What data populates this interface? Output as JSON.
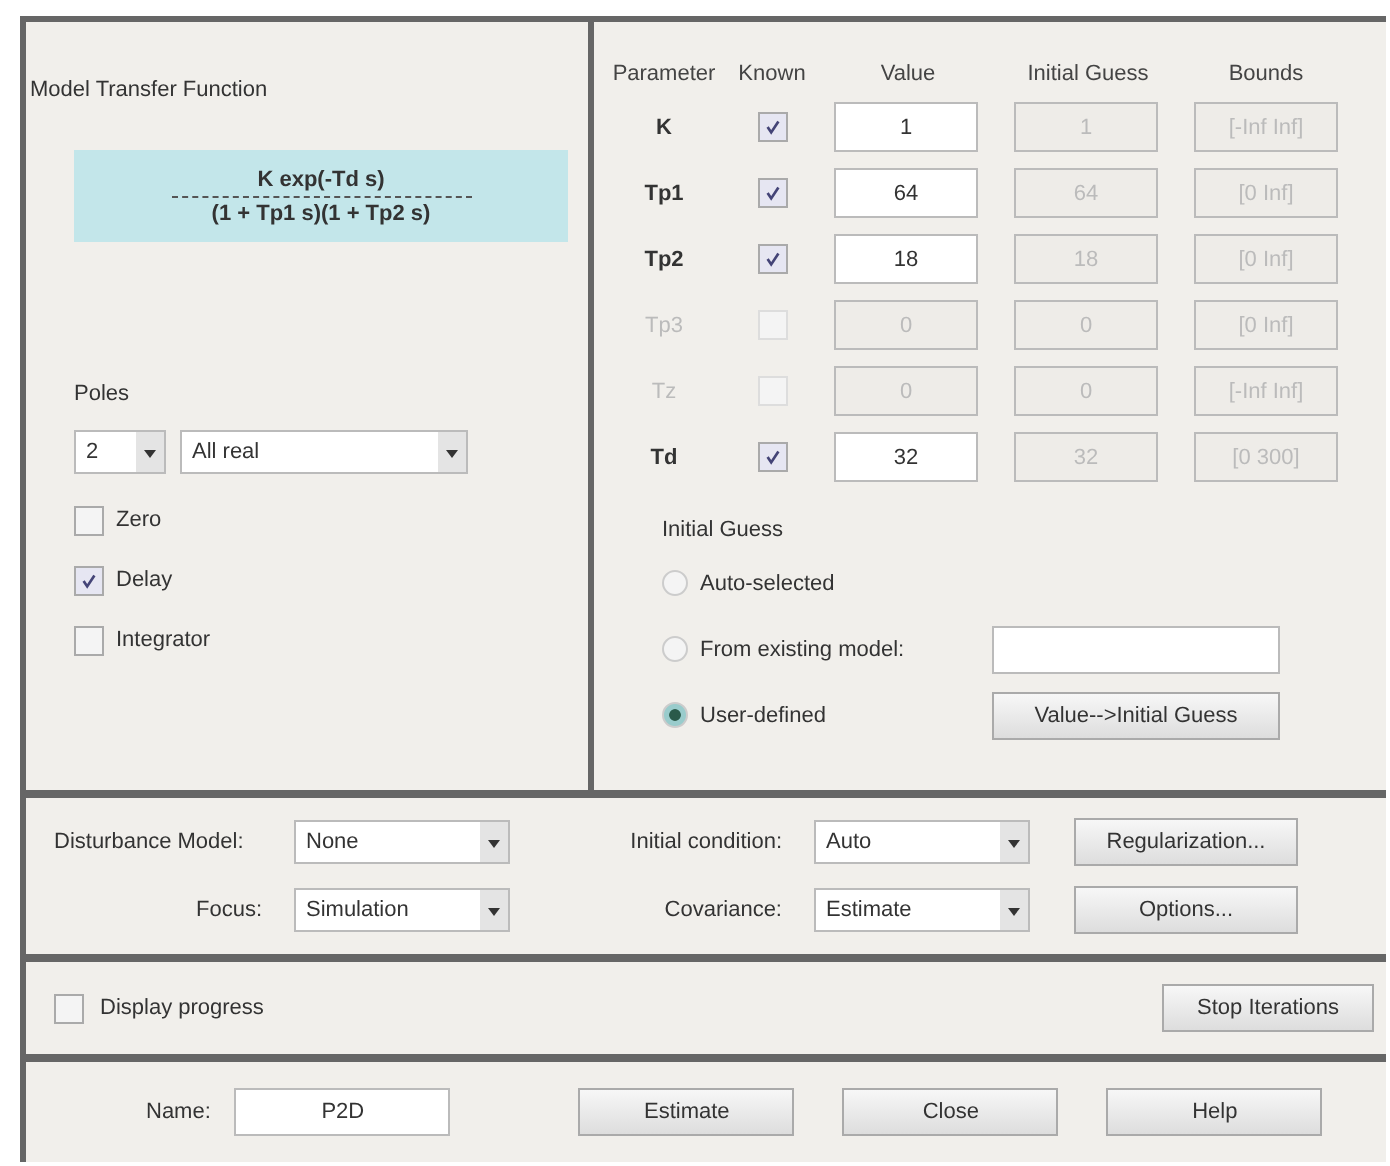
{
  "model_panel": {
    "title": "Model Transfer Function",
    "numerator": "K exp(-Td s)",
    "denominator": "(1 + Tp1 s)(1 + Tp2 s)",
    "poles_label": "Poles",
    "poles_count": "2",
    "poles_type": "All real",
    "options": [
      {
        "label": "Zero",
        "checked": false
      },
      {
        "label": "Delay",
        "checked": true
      },
      {
        "label": "Integrator",
        "checked": false
      }
    ]
  },
  "parameters": {
    "columns": [
      "Parameter",
      "Known",
      "Value",
      "Initial Guess",
      "Bounds"
    ],
    "rows": [
      {
        "name": "K",
        "known": true,
        "disabled": false,
        "value": "1",
        "initial_guess": "1",
        "bounds": "[-Inf Inf]"
      },
      {
        "name": "Tp1",
        "known": true,
        "disabled": false,
        "value": "64",
        "initial_guess": "64",
        "bounds": "[0 Inf]"
      },
      {
        "name": "Tp2",
        "known": true,
        "disabled": false,
        "value": "18",
        "initial_guess": "18",
        "bounds": "[0 Inf]"
      },
      {
        "name": "Tp3",
        "known": false,
        "disabled": true,
        "value": "0",
        "initial_guess": "0",
        "bounds": "[0 Inf]"
      },
      {
        "name": "Tz",
        "known": false,
        "disabled": true,
        "value": "0",
        "initial_guess": "0",
        "bounds": "[-Inf Inf]"
      },
      {
        "name": "Td",
        "known": true,
        "disabled": false,
        "value": "32",
        "initial_guess": "32",
        "bounds": "[0 300]"
      }
    ],
    "initial_guess_label": "Initial Guess",
    "radios": [
      {
        "label": "Auto-selected",
        "selected": false
      },
      {
        "label": "From existing model:",
        "selected": false
      },
      {
        "label": "User-defined",
        "selected": true
      }
    ],
    "value_to_guess_button": "Value-->Initial Guess"
  },
  "settings": {
    "disturbance_label": "Disturbance Model:",
    "disturbance": "None",
    "focus_label": "Focus:",
    "focus": "Simulation",
    "initial_condition_label": "Initial condition:",
    "initial_condition": "Auto",
    "covariance_label": "Covariance:",
    "covariance": "Estimate",
    "regularization_button": "Regularization...",
    "options_button": "Options..."
  },
  "progress": {
    "label": "Display progress",
    "checked": false,
    "stop_button": "Stop Iterations"
  },
  "footer": {
    "name_label": "Name:",
    "name": "P2D",
    "buttons": [
      "Estimate",
      "Close",
      "Help"
    ]
  }
}
